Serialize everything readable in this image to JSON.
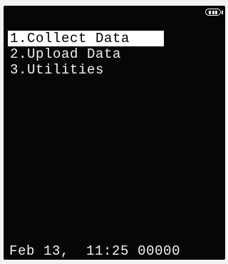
{
  "status_icons": {
    "battery_icon": "battery-icon",
    "battery_level": 3
  },
  "menu": {
    "items": [
      {
        "label": "1.Collect Data",
        "selected": true
      },
      {
        "label": "2.Upload Data",
        "selected": false
      },
      {
        "label": "3.Utilities",
        "selected": false
      }
    ]
  },
  "status_bar": {
    "date": "Feb 13,",
    "time": "11:25",
    "counter": "00000"
  },
  "colors": {
    "screen_background": "#060606",
    "text": "#f2f2f2",
    "highlight_background": "#ffffff",
    "highlight_text": "#000000"
  }
}
